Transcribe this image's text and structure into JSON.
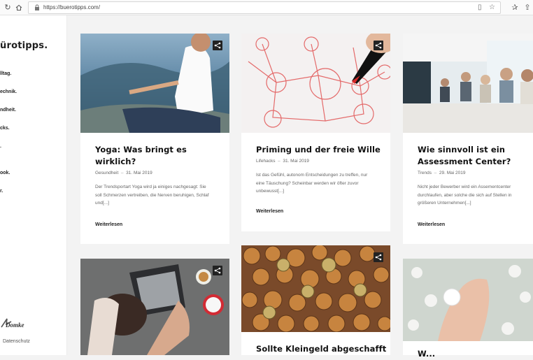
{
  "browser": {
    "url": "https://buerotipps.com/"
  },
  "sidebar": {
    "logo": "ürotipps",
    "logo_dot": ".",
    "items": [
      {
        "label": "lltag."
      },
      {
        "label": "echnik."
      },
      {
        "label": "ndheit."
      },
      {
        "label": "cks."
      },
      {
        "label": "."
      },
      {
        "label": "ook."
      },
      {
        "label": "r."
      }
    ],
    "brand": "Domke",
    "privacy": "Datenschutz"
  },
  "cards": [
    {
      "title_line1": "Yoga: Was bringt es",
      "title_line2": "wirklich?",
      "category": "Gesundheit",
      "separator": "–",
      "date": "31. Mai 2019",
      "excerpt": "Der Trendsportart Yoga wird ja einiges nachgesagt: Sie soll Schmerzen vertreiben, die Nerven beruhigen, Schlaf und[...]",
      "more": "Weiterlesen"
    },
    {
      "title_line1": "Priming und der freie Wille",
      "title_line2": "",
      "category": "Lifehacks",
      "separator": "–",
      "date": "31. Mai 2019",
      "excerpt": "Ist das Gefühl, autonom Entscheidungen zu treffen, nur eine Täuschung? Scheinbar werden wir öfter zuvor unbewusst[...]",
      "more": "Weiterlesen"
    },
    {
      "title_line1": "Wie sinnvoll ist ein",
      "title_line2": "Assessment Center?",
      "category": "Trends",
      "separator": "–",
      "date": "29. Mai 2019",
      "excerpt": "Nicht jeder Bewerber wird ein Assementcenter durchlaufen, aber solche die sich auf Stellen in größeren Unternehmen[...]",
      "more": "Weiterlesen"
    },
    {
      "title_line1": "",
      "title_line2": ""
    },
    {
      "title_line1": "Sollte Kleingeld abgeschafft",
      "title_line2": ""
    },
    {
      "title_line1": "W...",
      "title_line2": ""
    }
  ]
}
